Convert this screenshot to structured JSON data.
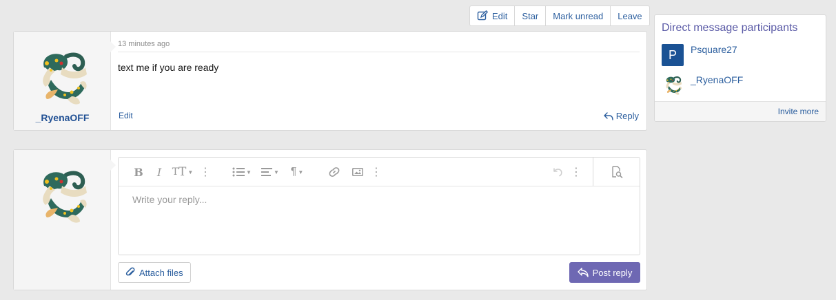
{
  "actions": {
    "edit": "Edit",
    "star": "Star",
    "mark_unread": "Mark unread",
    "leave": "Leave"
  },
  "message": {
    "username": "_RyenaOFF",
    "timestamp": "13 minutes ago",
    "text": "text me if you are ready",
    "edit_label": "Edit",
    "reply_label": "Reply"
  },
  "reply_form": {
    "placeholder": "Write your reply...",
    "attach_label": "Attach files",
    "post_label": "Post reply"
  },
  "sidebar": {
    "title": "Direct message participants",
    "participants": [
      {
        "initial": "P",
        "name": "Psquare27"
      },
      {
        "name": "_RyenaOFF"
      }
    ],
    "invite_label": "Invite more"
  },
  "colors": {
    "link": "#2b5e9e",
    "post_button": "#6e68b3",
    "sidebar_title": "#5a5aa6",
    "avatar_letter_bg": "#1a5294"
  }
}
